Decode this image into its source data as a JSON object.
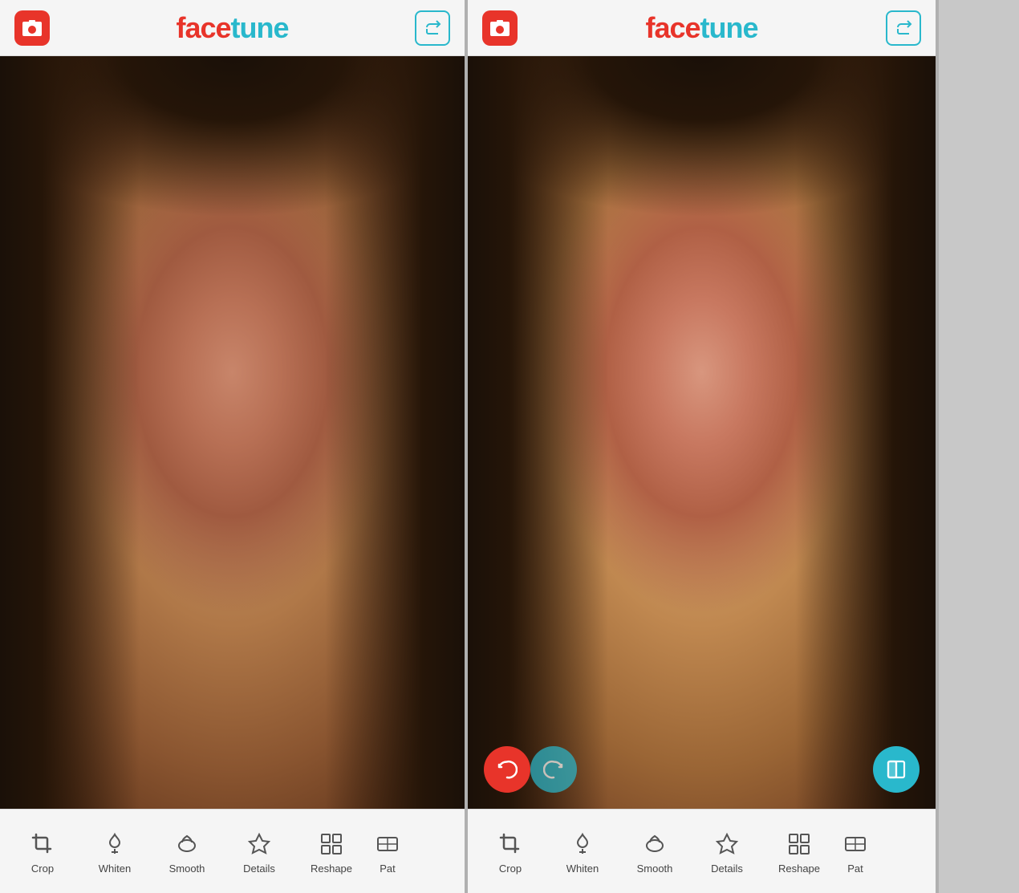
{
  "app": {
    "name": "facetune",
    "logo_face": "face",
    "logo_tune": "tune"
  },
  "panels": [
    {
      "id": "before",
      "type": "before"
    },
    {
      "id": "after",
      "type": "after"
    }
  ],
  "header": {
    "photo_btn_label": "photo",
    "share_btn_label": "share"
  },
  "toolbar": {
    "tools": [
      {
        "id": "crop",
        "label": "Crop"
      },
      {
        "id": "whiten",
        "label": "Whiten"
      },
      {
        "id": "smooth",
        "label": "Smooth"
      },
      {
        "id": "details",
        "label": "Details"
      },
      {
        "id": "reshape",
        "label": "Reshape"
      },
      {
        "id": "patch",
        "label": "Pat"
      }
    ]
  },
  "action_buttons": {
    "undo_label": "undo",
    "redo_label": "redo",
    "compare_label": "compare"
  },
  "colors": {
    "red": "#e8342a",
    "teal": "#29b8cc",
    "toolbar_bg": "#f5f5f5",
    "text": "#444444"
  }
}
